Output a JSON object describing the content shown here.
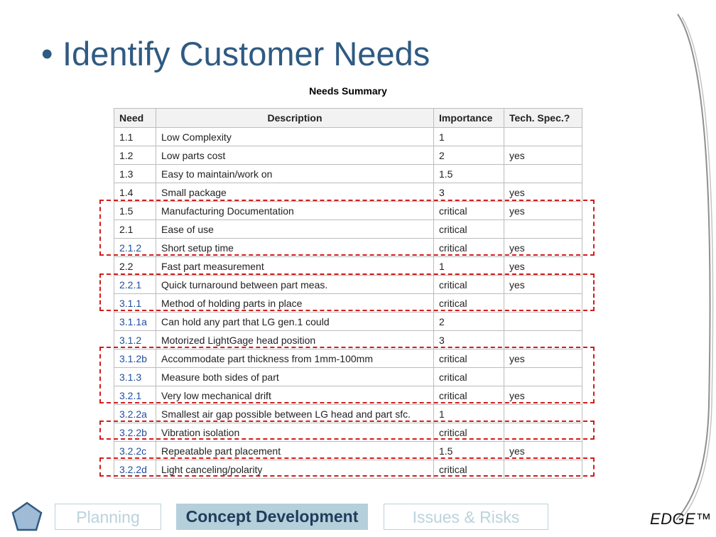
{
  "title": {
    "bullet": "•",
    "text": "Identify Customer Needs"
  },
  "table": {
    "caption": "Needs Summary",
    "headers": {
      "need": "Need",
      "description": "Description",
      "importance": "Importance",
      "tech_spec": "Tech. Spec.?"
    },
    "rows": [
      {
        "need": "1.1",
        "description": "Low Complexity",
        "importance": "1",
        "tech_spec": ""
      },
      {
        "need": "1.2",
        "description": "Low parts cost",
        "importance": "2",
        "tech_spec": "yes"
      },
      {
        "need": "1.3",
        "description": "Easy to maintain/work on",
        "importance": "1.5",
        "tech_spec": ""
      },
      {
        "need": "1.4",
        "description": "Small package",
        "importance": "3",
        "tech_spec": "yes"
      },
      {
        "need": "1.5",
        "description": "Manufacturing Documentation",
        "importance": "critical",
        "tech_spec": "yes"
      },
      {
        "need": "2.1",
        "description": "Ease of use",
        "importance": "critical",
        "tech_spec": ""
      },
      {
        "need": "2.1.2",
        "description": "Short setup time",
        "importance": "critical",
        "tech_spec": "yes"
      },
      {
        "need": "2.2",
        "description": "Fast part measurement",
        "importance": "1",
        "tech_spec": "yes"
      },
      {
        "need": "2.2.1",
        "description": "Quick turnaround between part meas.",
        "importance": "critical",
        "tech_spec": "yes"
      },
      {
        "need": "3.1.1",
        "description": "Method of holding parts in place",
        "importance": "critical",
        "tech_spec": ""
      },
      {
        "need": "3.1.1a",
        "description": "Can hold any part that LG gen.1 could",
        "importance": "2",
        "tech_spec": ""
      },
      {
        "need": "3.1.2",
        "description": "Motorized LightGage head position",
        "importance": "3",
        "tech_spec": ""
      },
      {
        "need": "3.1.2b",
        "description": "Accommodate part thickness from 1mm-100mm",
        "importance": "critical",
        "tech_spec": "yes"
      },
      {
        "need": "3.1.3",
        "description": "Measure both sides of part",
        "importance": "critical",
        "tech_spec": ""
      },
      {
        "need": "3.2.1",
        "description": "Very low mechanical drift",
        "importance": "critical",
        "tech_spec": "yes"
      },
      {
        "need": "3.2.2a",
        "description": "Smallest air gap possible between LG head and part sfc.",
        "importance": "1",
        "tech_spec": ""
      },
      {
        "need": "3.2.2b",
        "description": "Vibration isolation",
        "importance": "critical",
        "tech_spec": ""
      },
      {
        "need": "3.2.2c",
        "description": "Repeatable part placement",
        "importance": "1.5",
        "tech_spec": "yes"
      },
      {
        "need": "3.2.2d",
        "description": "Light canceling/polarity",
        "importance": "critical",
        "tech_spec": ""
      }
    ]
  },
  "nav": {
    "home_icon": "pentagon-home-icon",
    "tabs": [
      {
        "label": "Planning",
        "active": false
      },
      {
        "label": "Concept Development",
        "active": true
      },
      {
        "label": "Issues & Risks",
        "active": false
      }
    ]
  },
  "logo": {
    "text": "EDGE™"
  },
  "colors": {
    "title": "#2f5a82",
    "need_link": "#1f4e9e",
    "highlight": "#d21c1c",
    "tab_active_bg": "#b5cfdb",
    "tab_inactive": "#bcd2dc"
  }
}
